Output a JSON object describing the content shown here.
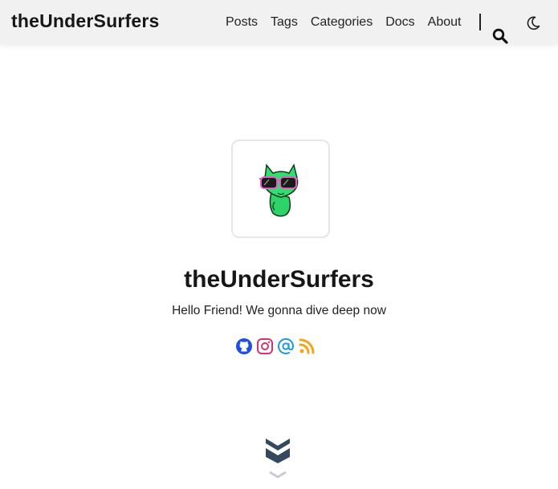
{
  "navbar": {
    "brand": "theUnderSurfers",
    "links": [
      "Posts",
      "Tags",
      "Categories",
      "Docs",
      "About"
    ],
    "search_icon": "search-icon",
    "theme_icon": "moon-icon"
  },
  "profile": {
    "avatar": "cat-with-sunglasses-avatar",
    "title": "theUnderSurfers",
    "subtitle": "Hello Friend! We gonna dive deep now"
  },
  "social": {
    "icons": [
      "github-icon",
      "instagram-icon",
      "email-icon",
      "rss-icon"
    ],
    "colors": {
      "github": "#1f4ee0",
      "instagram": "#d6336c",
      "email": "#1c9bd8",
      "rss": "#f2a41c"
    }
  },
  "scroll_icon": "double-chevron-down-icon"
}
